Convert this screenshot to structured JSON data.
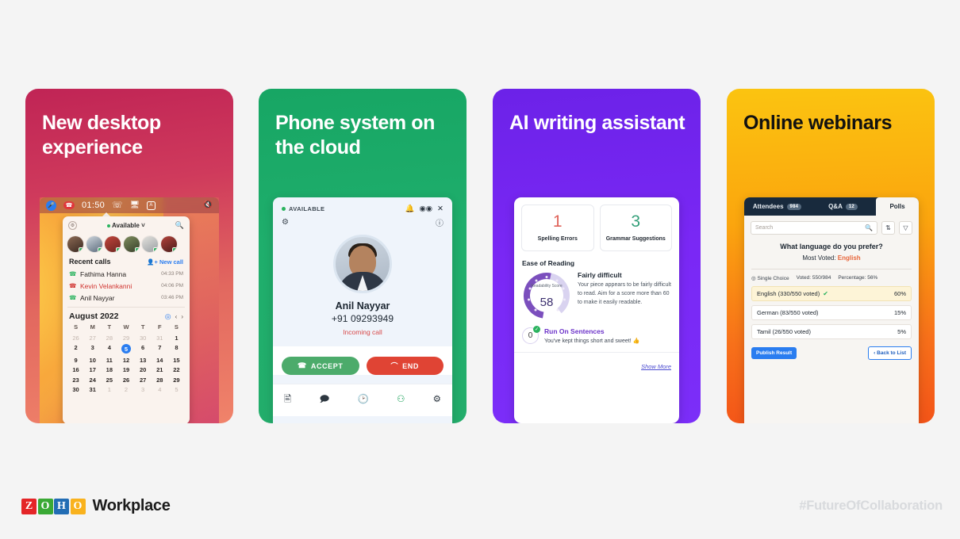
{
  "cards": [
    {
      "title": "New desktop experience",
      "menubar": {
        "time": "01:50",
        "mic_icon": "microphone-icon",
        "hangup_icon": "hangup-icon",
        "cliq_icon": "cliq-icon",
        "screen_icon": "screen-share-icon",
        "lang_icon": "keyboard-language-icon",
        "mute_icon": "mute-icon",
        "lang_label": "A"
      },
      "panel": {
        "status": "Available",
        "status_caret": "chevron-down-icon",
        "search_icon": "search-icon",
        "settings_icon": "settings-icon",
        "recent_calls_label": "Recent calls",
        "new_call_label": "New call",
        "calls": [
          {
            "name": "Fathima Hanna",
            "time": "04:33 PM",
            "type": "incoming"
          },
          {
            "name": "Kevin Velankanni",
            "time": "04:06 PM",
            "type": "missed"
          },
          {
            "name": "Anil Nayyar",
            "time": "03:46 PM",
            "type": "incoming"
          }
        ],
        "calendar": {
          "month": "August 2022",
          "dow": [
            "S",
            "M",
            "T",
            "W",
            "T",
            "F",
            "S"
          ],
          "selected": 5,
          "weeks": [
            [
              {
                "d": "26",
                "mut": true
              },
              {
                "d": "27",
                "mut": true
              },
              {
                "d": "28",
                "mut": true
              },
              {
                "d": "29",
                "mut": true
              },
              {
                "d": "30",
                "mut": true
              },
              {
                "d": "31",
                "mut": true
              },
              {
                "d": "1"
              }
            ],
            [
              {
                "d": "2"
              },
              {
                "d": "3"
              },
              {
                "d": "4"
              },
              {
                "d": "5",
                "sel": true
              },
              {
                "d": "6"
              },
              {
                "d": "7"
              },
              {
                "d": "8"
              }
            ],
            [
              {
                "d": "9"
              },
              {
                "d": "10"
              },
              {
                "d": "11"
              },
              {
                "d": "12"
              },
              {
                "d": "13"
              },
              {
                "d": "14"
              },
              {
                "d": "15"
              }
            ],
            [
              {
                "d": "16"
              },
              {
                "d": "17"
              },
              {
                "d": "18"
              },
              {
                "d": "19"
              },
              {
                "d": "20"
              },
              {
                "d": "21"
              },
              {
                "d": "22"
              }
            ],
            [
              {
                "d": "23"
              },
              {
                "d": "24"
              },
              {
                "d": "25"
              },
              {
                "d": "26"
              },
              {
                "d": "27"
              },
              {
                "d": "28"
              },
              {
                "d": "29"
              }
            ],
            [
              {
                "d": "30"
              },
              {
                "d": "31"
              },
              {
                "d": "1",
                "mut": true
              },
              {
                "d": "2",
                "mut": true
              },
              {
                "d": "3",
                "mut": true
              },
              {
                "d": "4",
                "mut": true
              },
              {
                "d": "5",
                "mut": true
              }
            ]
          ]
        }
      }
    },
    {
      "title": "Phone system on the cloud",
      "phone": {
        "status": "AVAILABLE",
        "bell_icon": "bell-icon",
        "voicemail_icon": "voicemail-icon",
        "close_icon": "close-icon",
        "settings_icon": "settings-gear-icon",
        "info_icon": "info-icon",
        "caller_name": "Anil Nayyar",
        "caller_number": "+91 09293949",
        "call_state": "Incoming call",
        "accept_label": "ACCEPT",
        "end_label": "END",
        "tabs": [
          "contacts-icon",
          "messages-icon",
          "history-icon",
          "dialpad-icon",
          "settings-icon"
        ]
      }
    },
    {
      "title": "AI writing assistant",
      "ai": {
        "stats": [
          {
            "value": "1",
            "label": "Spelling Errors",
            "color": "#e0635a"
          },
          {
            "value": "3",
            "label": "Grammar Suggestions",
            "color": "#35a07a"
          }
        ],
        "section_title": "Ease of Reading",
        "gauge_label": "Readability Score",
        "gauge_value": "58",
        "verdict": "Fairly difficult",
        "verdict_body": "Your piece appears to be fairly difficult to read. Aim for a score more than 60 to make it easily readable.",
        "run_on_count": "0",
        "run_on_title": "Run On Sentences",
        "run_on_body": "You've kept things short and sweet! 👍",
        "show_more": "Show More"
      }
    },
    {
      "title": "Online webinars",
      "webinar": {
        "tabs": [
          {
            "label": "Attendees",
            "badge": "984",
            "active": false
          },
          {
            "label": "Q&A",
            "badge": "12",
            "active": false
          },
          {
            "label": "Polls",
            "badge": "",
            "active": true
          }
        ],
        "search_placeholder": "Search",
        "search_icon": "search-icon",
        "sort_icon": "sort-icon",
        "filter_icon": "filter-icon",
        "question": "What language do you prefer?",
        "most_voted_label": "Most Voted:",
        "most_voted_value": "English",
        "meta": [
          "Single Choice",
          "Voted: 550/984",
          "Percentage: 56%"
        ],
        "options": [
          {
            "label": "English (330/550 voted)",
            "pct": "60%",
            "lead": true
          },
          {
            "label": "German (83/550 voted)",
            "pct": "15%",
            "lead": false
          },
          {
            "label": "Tamil (26/550 voted)",
            "pct": "5%",
            "lead": false
          }
        ],
        "publish_label": "Publish Result",
        "back_label": "Back to List"
      }
    }
  ],
  "footer": {
    "brand_tiles": [
      "Z",
      "O",
      "H",
      "O"
    ],
    "product": "Workplace",
    "hashtag": "#FutureOfCollaboration"
  }
}
